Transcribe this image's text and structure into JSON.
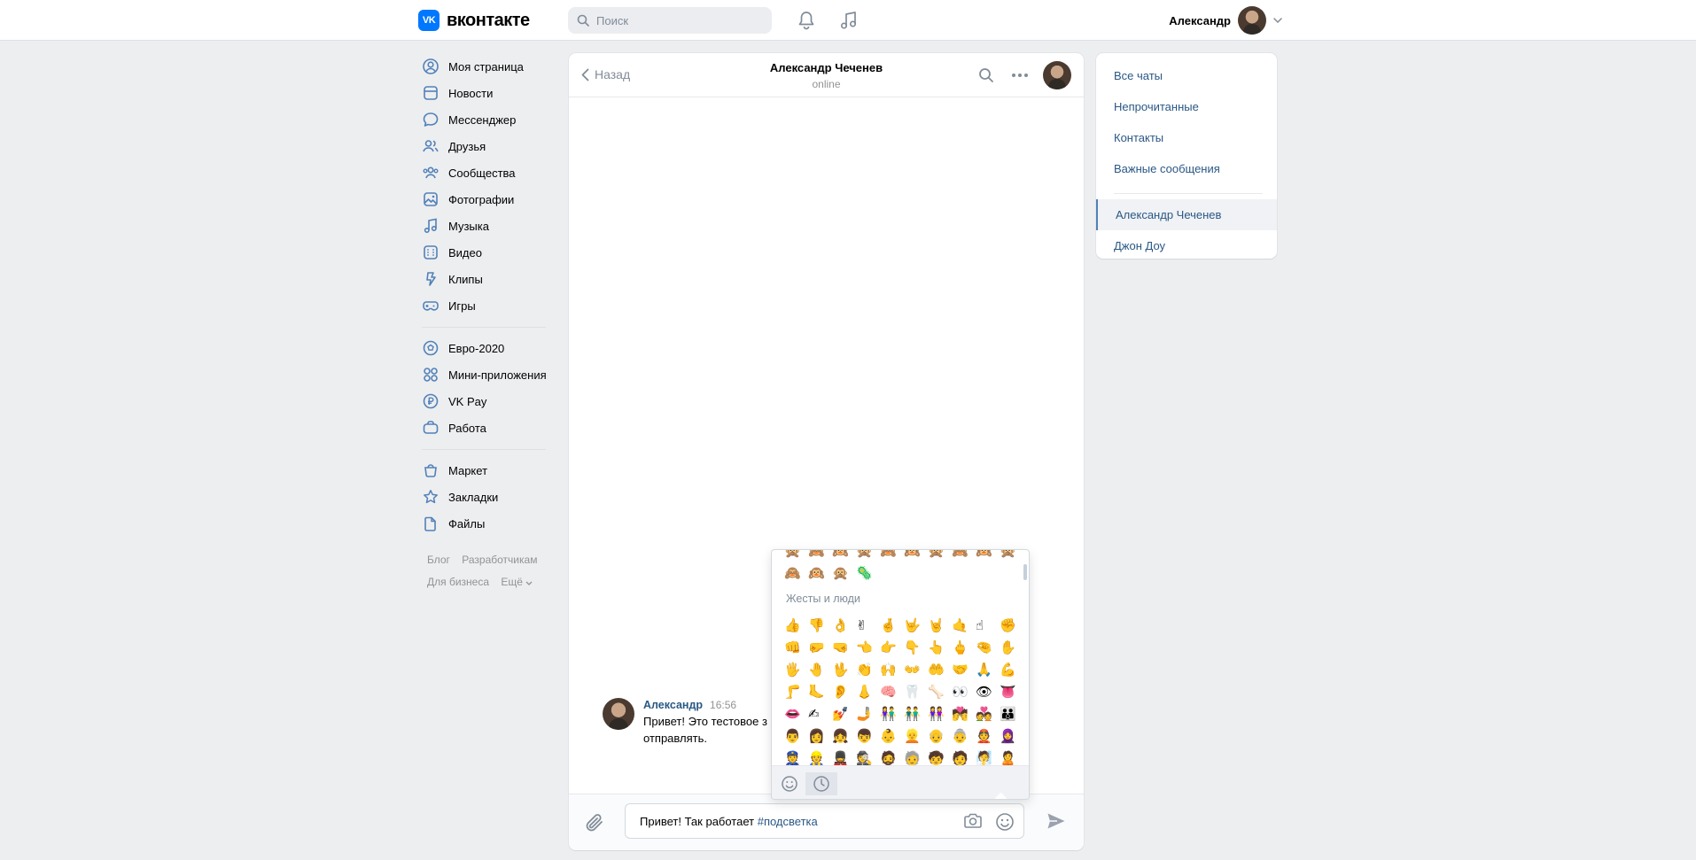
{
  "header": {
    "logo_mark": "VK",
    "logo_text": "вконтакте",
    "search_placeholder": "Поиск",
    "user_name": "Александр"
  },
  "sidebar": {
    "items": [
      {
        "label": "Моя страница",
        "icon": "user-circle-icon"
      },
      {
        "label": "Новости",
        "icon": "news-icon"
      },
      {
        "label": "Мессенджер",
        "icon": "message-icon"
      },
      {
        "label": "Друзья",
        "icon": "friends-icon"
      },
      {
        "label": "Сообщества",
        "icon": "communities-icon"
      },
      {
        "label": "Фотографии",
        "icon": "photo-icon"
      },
      {
        "label": "Музыка",
        "icon": "music-icon"
      },
      {
        "label": "Видео",
        "icon": "video-icon"
      },
      {
        "label": "Клипы",
        "icon": "clips-icon"
      },
      {
        "label": "Игры",
        "icon": "games-icon"
      }
    ],
    "items2": [
      {
        "label": "Евро-2020",
        "icon": "ball-icon"
      },
      {
        "label": "Мини-приложения",
        "icon": "apps-icon"
      },
      {
        "label": "VK Pay",
        "icon": "vkpay-icon"
      },
      {
        "label": "Работа",
        "icon": "briefcase-icon"
      }
    ],
    "items3": [
      {
        "label": "Маркет",
        "icon": "market-icon"
      },
      {
        "label": "Закладки",
        "icon": "star-icon"
      },
      {
        "label": "Файлы",
        "icon": "file-icon"
      }
    ],
    "footer": {
      "blog": "Блог",
      "developers": "Разработчикам",
      "business": "Для бизнеса",
      "more": "Ещё"
    }
  },
  "chat": {
    "back_label": "Назад",
    "peer_name": "Александр Чеченев",
    "peer_status": "online",
    "message": {
      "author": "Александр",
      "time": "16:56",
      "text_line1": "Привет! Это тестовое з",
      "text_line2": "отправлять."
    },
    "composer": {
      "text": "Привет! Так работает ",
      "hashtag": "#подсветка"
    }
  },
  "emoji": {
    "section_title": "Жесты и люди",
    "partial_row": [
      "🙊",
      "🙈",
      "🙉",
      "🙊",
      "🙈",
      "🙉",
      "🙊",
      "🙈",
      "🙉",
      "🙊"
    ],
    "top_row": [
      "🙈",
      "🙉",
      "🙊",
      "🦠"
    ],
    "rows": [
      [
        "👍",
        "👎",
        "👌",
        "✌",
        "🤞",
        "🤟",
        "🤘",
        "🤙",
        "☝",
        "✊"
      ],
      [
        "👊",
        "🤛",
        "🤜",
        "👈",
        "👉",
        "👇",
        "👆",
        "🖕",
        "🤏",
        "✋"
      ],
      [
        "🖐",
        "🤚",
        "🖖",
        "👏",
        "🙌",
        "👐",
        "🤲",
        "🤝",
        "🙏",
        "💪"
      ],
      [
        "🦵",
        "🦶",
        "👂",
        "👃",
        "🧠",
        "🦷",
        "🦴",
        "👀",
        "👁",
        "👅"
      ],
      [
        "👄",
        "✍",
        "💅",
        "🤳",
        "👫",
        "👬",
        "👭",
        "💏",
        "💑",
        "👪"
      ],
      [
        "👨",
        "👩",
        "👧",
        "👦",
        "👶",
        "👱",
        "👴",
        "👵",
        "👲",
        "🧕"
      ],
      [
        "👮",
        "👷",
        "💂",
        "🕵",
        "🧔",
        "🧓",
        "🧒",
        "🧑",
        "🧖",
        "🙎"
      ]
    ]
  },
  "right_panel": {
    "items": [
      "Все чаты",
      "Непрочитанные",
      "Контакты",
      "Важные сообщения"
    ],
    "chats": [
      "Александр Чеченев",
      "Джон Доу"
    ]
  },
  "colors": {
    "accent": "#0077ff",
    "link": "#2a5885",
    "background": "#edeef0"
  }
}
